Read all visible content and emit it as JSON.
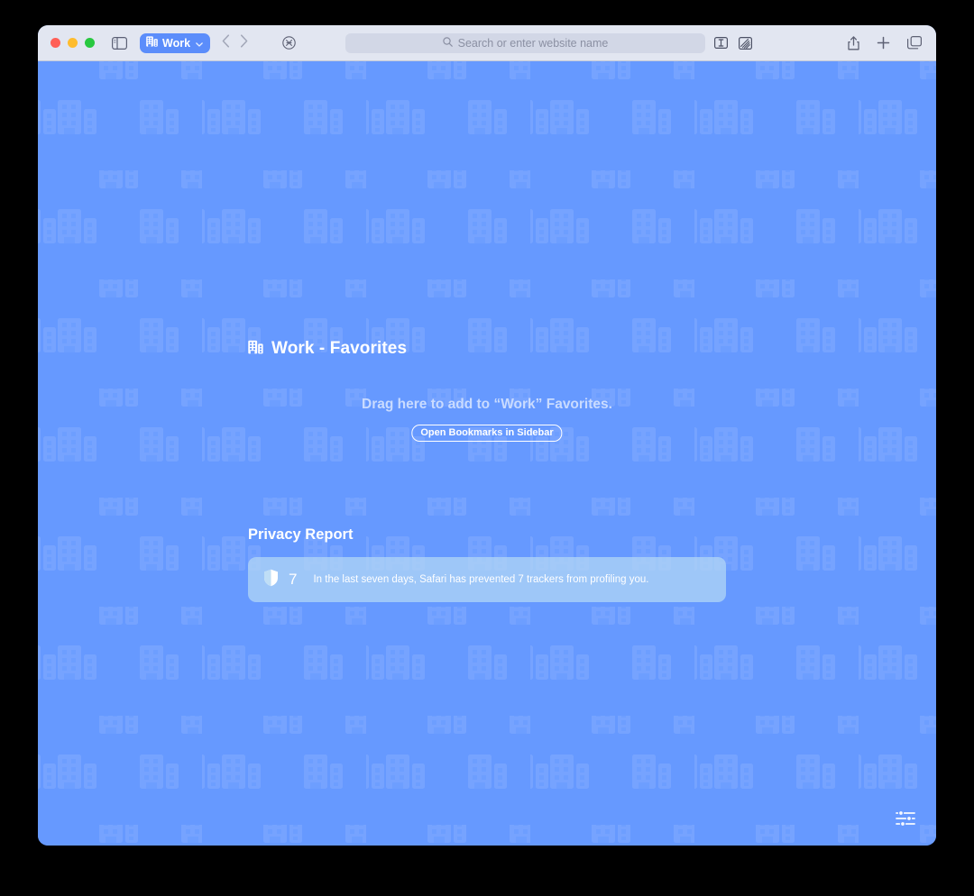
{
  "window": {
    "traffic_lights": [
      {
        "name": "close",
        "color": "#ff5f57"
      },
      {
        "name": "minimize",
        "color": "#febc2e"
      },
      {
        "name": "zoom",
        "color": "#28c840"
      }
    ]
  },
  "toolbar": {
    "sidebar_toggle_icon": "sidebar-icon",
    "profile": {
      "label": "Work",
      "icon": "building-icon",
      "chevron": "chevron-down-icon",
      "color": "#5b8dfb"
    },
    "back_icon": "chevron-left-icon",
    "forward_icon": "chevron-right-icon",
    "shield_icon": "privacy-shield-icon",
    "address_bar": {
      "value": "",
      "placeholder": "Search or enter website name",
      "search_icon": "search-icon"
    },
    "reader_icon": "reader-mode-icon",
    "extensions_icon": "extensions-icon",
    "share_icon": "share-icon",
    "new_tab_icon": "plus-icon",
    "tab_overview_icon": "tab-overview-icon"
  },
  "startpage": {
    "background_color": "#6699ff",
    "pattern_icon": "building-icon",
    "heading": {
      "icon": "building-icon",
      "title": "Work - Favorites"
    },
    "drag_prompt": "Drag here to add to “Work” Favorites.",
    "open_bookmarks_label": "Open Bookmarks in Sidebar",
    "privacy": {
      "section_title": "Privacy Report",
      "shield_icon": "shield-icon",
      "count": "7",
      "message": "In the last seven days, Safari has prevented 7 trackers from profiling you."
    },
    "settings_icon": "sliders-icon"
  }
}
